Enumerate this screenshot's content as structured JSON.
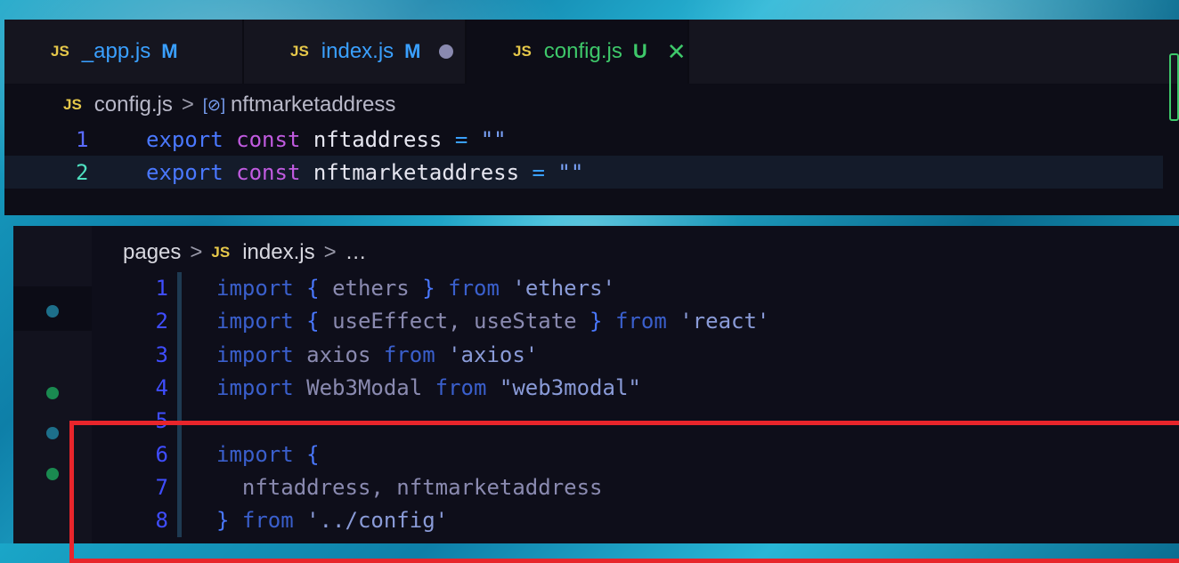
{
  "top_editor": {
    "tabs": [
      {
        "icon": "JS",
        "name": "_app.js",
        "status": "M",
        "name_color": "#3aa0ff",
        "status_color": "#3aa0ff",
        "active": false
      },
      {
        "icon": "JS",
        "name": "index.js",
        "status": "M",
        "name_color": "#3aa0ff",
        "status_color": "#3aa0ff",
        "active": false,
        "unsaved_dot": true
      },
      {
        "icon": "JS",
        "name": "config.js",
        "status": "U",
        "name_color": "#3ec86a",
        "status_color": "#3ec86a",
        "active": true,
        "close": "✕"
      }
    ],
    "breadcrumb": {
      "icon": "JS",
      "file": "config.js",
      "sep": ">",
      "symbol_icon": "[⊘]",
      "symbol": "nftmarketaddress"
    },
    "lines": [
      {
        "number": "1",
        "tokens": [
          "export",
          "const",
          "nftaddress",
          "=",
          "\"\""
        ]
      },
      {
        "number": "2",
        "tokens": [
          "export",
          "const",
          "nftmarketaddress",
          "=",
          "\"\""
        ],
        "current": true
      }
    ]
  },
  "bottom_editor": {
    "breadcrumb": {
      "folder": "pages",
      "sep": ">",
      "icon": "JS",
      "file": "index.js",
      "ellipsis": "…"
    },
    "lines": [
      {
        "number": "1",
        "text": [
          "import",
          " { ",
          "ethers",
          " } ",
          "from",
          " ",
          "'ethers'"
        ]
      },
      {
        "number": "2",
        "text": [
          "import",
          " { ",
          "useEffect, useState",
          " } ",
          "from",
          " ",
          "'react'"
        ]
      },
      {
        "number": "3",
        "text": [
          "import",
          " ",
          "axios",
          " ",
          "from",
          " ",
          "'axios'"
        ]
      },
      {
        "number": "4",
        "text": [
          "import",
          " ",
          "Web3Modal",
          " ",
          "from",
          " ",
          "\"web3modal\""
        ]
      },
      {
        "number": "5",
        "text": []
      },
      {
        "number": "6",
        "text": [
          "import",
          " {",
          "",
          "",
          "",
          "",
          ""
        ]
      },
      {
        "number": "7",
        "text": [
          "",
          "  ",
          "nftaddress, nftmarketaddress",
          "",
          "",
          "",
          ""
        ]
      },
      {
        "number": "8",
        "text": [
          "",
          "} ",
          "",
          "",
          "from",
          " ",
          "'../config'"
        ]
      }
    ],
    "gutter_markers": [
      {
        "color": "#1d6f8a"
      },
      {
        "color": "#1a8a50"
      },
      {
        "color": "#1d6f8a"
      },
      {
        "color": "#1a8a50"
      }
    ]
  },
  "annotation_color": "#e8252b"
}
